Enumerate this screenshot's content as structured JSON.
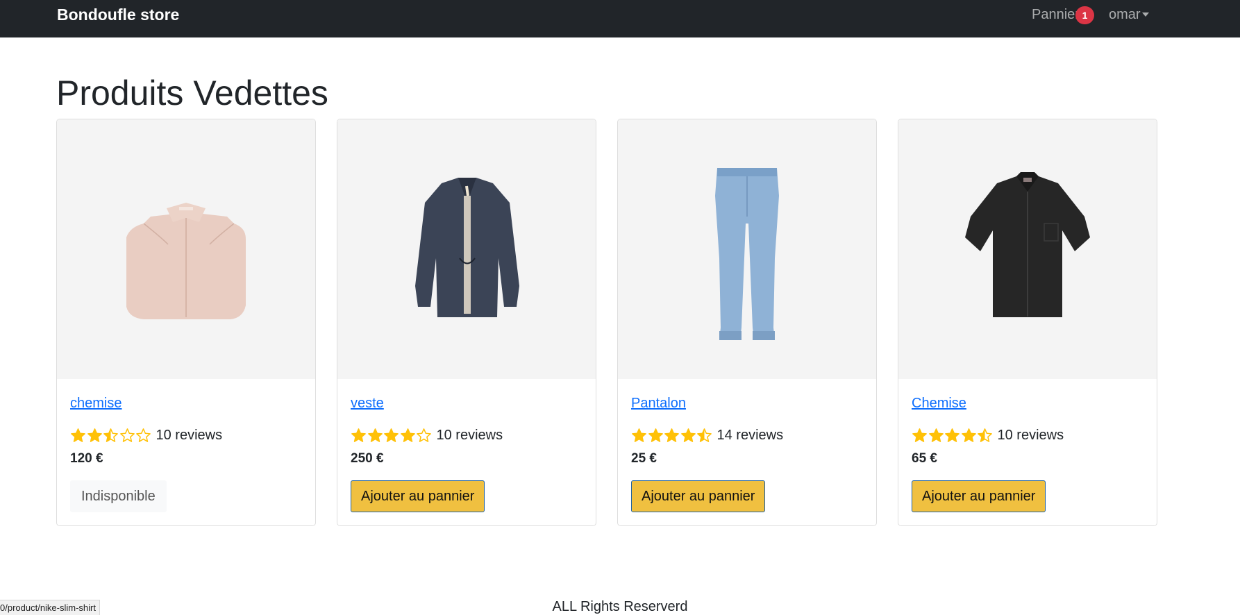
{
  "navbar": {
    "brand": "Bondoufle store",
    "cart_label": "Pannier",
    "cart_count": "1",
    "user_label": "omar"
  },
  "page": {
    "title": "Produits Vedettes"
  },
  "products": [
    {
      "name": "chemise",
      "rating": 2.5,
      "reviews": "10 reviews",
      "price": "120 €",
      "action_label": "Indisponible",
      "in_stock": false,
      "image": "beige halter shirt"
    },
    {
      "name": "veste",
      "rating": 4,
      "reviews": "10 reviews",
      "price": "250 €",
      "action_label": "Ajouter au pannier",
      "in_stock": true,
      "image": "navy kimono jacket"
    },
    {
      "name": "Pantalon",
      "rating": 4.5,
      "reviews": "14 reviews",
      "price": "25 €",
      "action_label": "Ajouter au pannier",
      "in_stock": true,
      "image": "light blue jeans"
    },
    {
      "name": "Chemise",
      "rating": 4.5,
      "reviews": "10 reviews",
      "price": "65 €",
      "action_label": "Ajouter au pannier",
      "in_stock": true,
      "image": "black short-sleeve shirt"
    }
  ],
  "footer": {
    "text": "ALL Rights Reserverd"
  },
  "status_bar": {
    "url": "0/product/nike-slim-shirt"
  },
  "colors": {
    "navbar_bg": "#212529",
    "link": "#0d6efd",
    "star": "#ffc107",
    "badge": "#dc3545",
    "button": "#f0c040"
  }
}
